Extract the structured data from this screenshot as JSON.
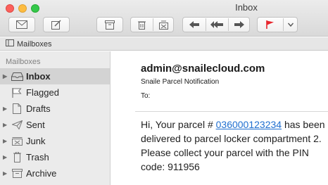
{
  "window": {
    "title": "Inbox"
  },
  "toolbar": {
    "buttons": [
      {
        "name": "get-mail-button",
        "icon": "envelope-icon"
      },
      {
        "name": "compose-button",
        "icon": "compose-icon"
      },
      {
        "name": "archive-button",
        "icon": "archive-box-icon"
      },
      {
        "name": "delete-button",
        "icon": "trash-icon"
      },
      {
        "name": "junk-button",
        "icon": "junk-icon"
      },
      {
        "name": "reply-button",
        "icon": "reply-arrow-icon"
      },
      {
        "name": "reply-all-button",
        "icon": "reply-all-arrow-icon"
      },
      {
        "name": "forward-button",
        "icon": "forward-arrow-icon"
      },
      {
        "name": "flag-button",
        "icon": "flag-icon"
      },
      {
        "name": "flag-menu-button",
        "icon": "chevron-down-icon"
      }
    ],
    "flag_color": "#e8262d"
  },
  "favorites": {
    "mailboxes_label": "Mailboxes"
  },
  "sidebar": {
    "header": "Mailboxes",
    "items": [
      {
        "label": "Inbox",
        "icon": "inbox-tray-icon",
        "selected": true,
        "disclosure": true
      },
      {
        "label": "Flagged",
        "icon": "flag-outline-icon",
        "selected": false,
        "disclosure": false
      },
      {
        "label": "Drafts",
        "icon": "document-icon",
        "selected": false,
        "disclosure": true
      },
      {
        "label": "Sent",
        "icon": "paper-plane-icon",
        "selected": false,
        "disclosure": true
      },
      {
        "label": "Junk",
        "icon": "junk-tray-icon",
        "selected": false,
        "disclosure": true
      },
      {
        "label": "Trash",
        "icon": "trash-can-icon",
        "selected": false,
        "disclosure": true
      },
      {
        "label": "Archive",
        "icon": "archive-box-icon",
        "selected": false,
        "disclosure": true
      }
    ]
  },
  "message": {
    "from": "admin@snailecloud.com",
    "subject": "Snaile Parcel Notification",
    "to_label": "To:",
    "body_before_link": "Hi, Your parcel # ",
    "link_text": "036000123234",
    "body_after_link": " has been delivered to parcel locker compartment 2. Please collect your parcel with the PIN code: 911956",
    "link_color": "#1f6fd0"
  }
}
